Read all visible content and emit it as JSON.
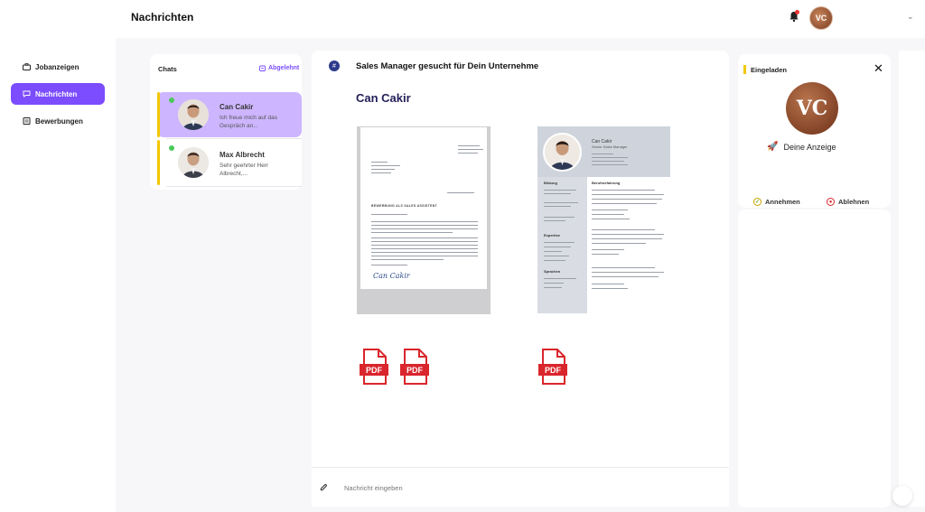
{
  "header": {
    "title": "Nachrichten",
    "avatar_initials": "VC"
  },
  "sidebar": {
    "items": [
      {
        "label": "Jobanzeigen",
        "icon": "briefcase-icon",
        "active": false
      },
      {
        "label": "Nachrichten",
        "icon": "chat-icon",
        "active": true
      },
      {
        "label": "Bewerbungen",
        "icon": "document-icon",
        "active": false
      }
    ]
  },
  "chats": {
    "title": "Chats",
    "archived_label": "Abgelehnt",
    "items": [
      {
        "name": "Can Cakir",
        "preview": "Ich freue mich auf das Gespräch an...",
        "selected": true,
        "online": true
      },
      {
        "name": "Max Albrecht",
        "preview": "Sehr geehrter Herr Albrecht,...",
        "selected": false,
        "online": true
      }
    ]
  },
  "conversation": {
    "job_title": "Sales Manager gesucht für Dein Unternehme",
    "applicant_name": "Can Cakir",
    "letter_heading": "BEWERBUNG ALS SALES ASSISTENT",
    "letter_signature": "Can Cakir",
    "cv_name": "Can Cakir",
    "cv_role": "Senior Sales Manager",
    "cv_sections": [
      "Bildung",
      "Berufserfahrung",
      "Expertise",
      "Sprachen"
    ],
    "attachments": [
      {
        "label": "PDF"
      },
      {
        "label": "PDF"
      },
      {
        "label": "PDF"
      }
    ],
    "message_placeholder": "Nachricht eingeben"
  },
  "status_panel": {
    "label": "Eingeladen",
    "logo_text": "VC",
    "ad_link": "Deine Anzeige",
    "accept_label": "Annehmen",
    "reject_label": "Ablehnen"
  },
  "colors": {
    "accent": "#7b4dff",
    "selected_chat": "#cdb6ff",
    "status_bar": "#f3c800",
    "online": "#4cc85a",
    "pdf_red": "#d9262c",
    "name_navy": "#23205a"
  }
}
